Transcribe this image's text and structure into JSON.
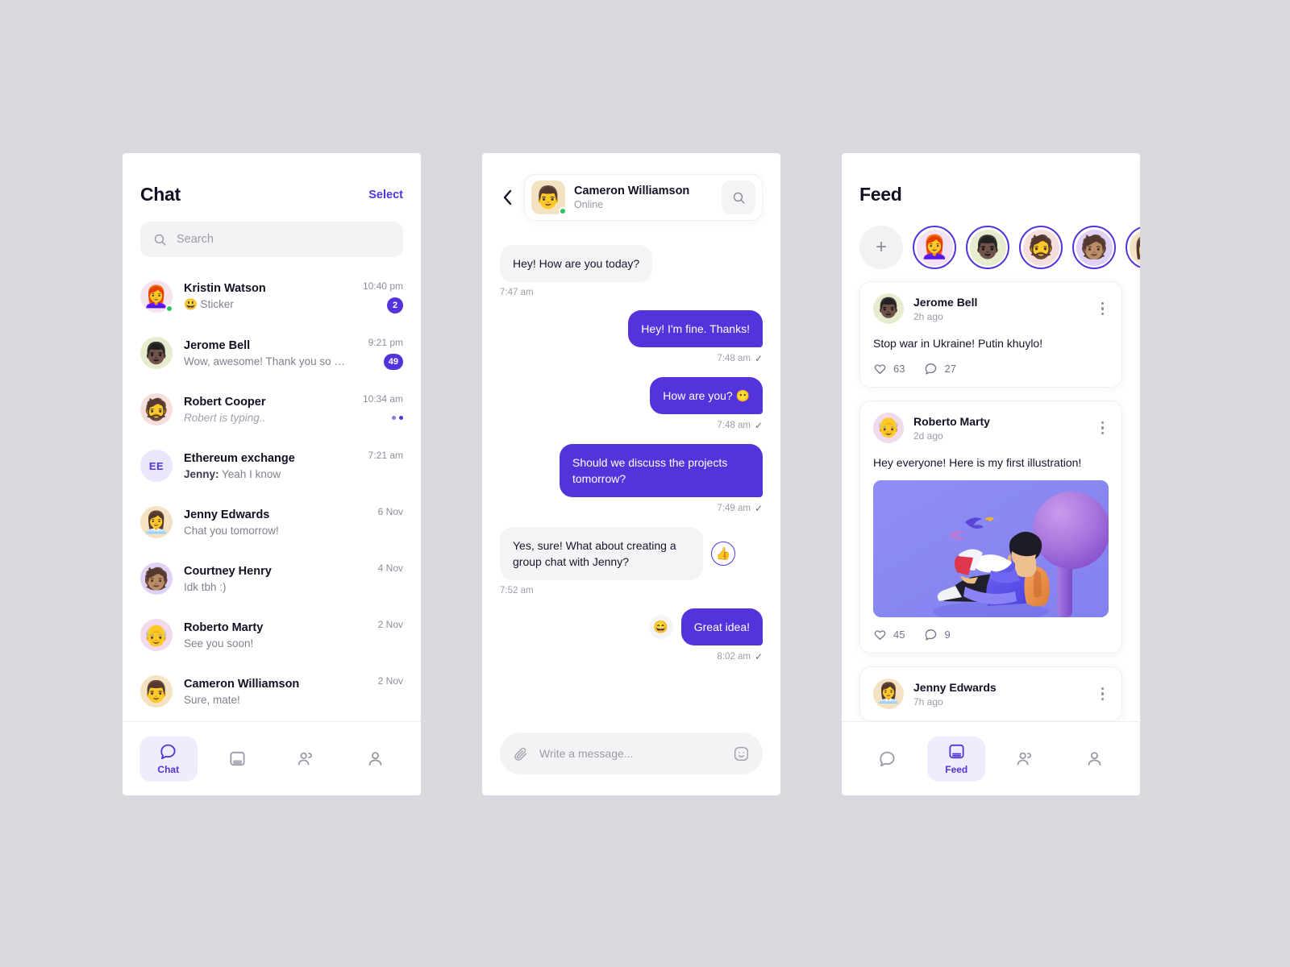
{
  "theme": {
    "accent": "#5433dc",
    "accent_soft": "#efecfd",
    "bg": "#d9dadf",
    "panel": "#ffffff",
    "muted": "#9a9aa8",
    "online": "#2fc05c"
  },
  "chat_panel": {
    "title": "Chat",
    "select_label": "Select",
    "search": {
      "placeholder": "Search",
      "value": "",
      "icon": "search-icon"
    },
    "rows": [
      {
        "name": "Kristin Watson",
        "preview": "😃 Sticker",
        "sender": "",
        "time": "10:40 pm",
        "badge": "2",
        "typing": false,
        "online": true,
        "emoji": "👩‍🦰",
        "av_bg": "#f5e4f0",
        "initials": ""
      },
      {
        "name": "Jerome Bell",
        "preview": "Wow, awesome! Thank you so much..",
        "sender": "",
        "time": "9:21 pm",
        "badge": "49",
        "typing": false,
        "online": false,
        "emoji": "👨🏿",
        "av_bg": "#e6edcf",
        "initials": ""
      },
      {
        "name": "Robert Cooper",
        "preview": "Robert is typing..",
        "sender": "",
        "time": "10:34 am",
        "badge": "",
        "typing": true,
        "online": false,
        "emoji": "🧔",
        "av_bg": "#f6dedc",
        "initials": ""
      },
      {
        "name": "Ethereum exchange",
        "preview": "Yeah I know",
        "sender": "Jenny:",
        "time": "7:21 am",
        "badge": "",
        "typing": false,
        "online": false,
        "emoji": "",
        "av_bg": "#eae6fb",
        "initials": "EE"
      },
      {
        "name": "Jenny Edwards",
        "preview": "Chat you tomorrow!",
        "sender": "",
        "time": "6 Nov",
        "badge": "",
        "typing": false,
        "online": false,
        "emoji": "👩‍💼",
        "av_bg": "#f3e3c2",
        "initials": ""
      },
      {
        "name": "Courtney Henry",
        "preview": "Idk tbh :)",
        "sender": "",
        "time": "4 Nov",
        "badge": "",
        "typing": false,
        "online": false,
        "emoji": "🧑🏽",
        "av_bg": "#dfd2f5",
        "initials": ""
      },
      {
        "name": "Roberto Marty",
        "preview": "See you soon!",
        "sender": "",
        "time": "2 Nov",
        "badge": "",
        "typing": false,
        "online": false,
        "emoji": "👴",
        "av_bg": "#f0daec",
        "initials": ""
      },
      {
        "name": "Cameron Williamson",
        "preview": "Sure, mate!",
        "sender": "",
        "time": "2 Nov",
        "badge": "",
        "typing": false,
        "online": false,
        "emoji": "👨",
        "av_bg": "#f3e3c2",
        "initials": ""
      }
    ],
    "tabs": [
      {
        "label": "Chat",
        "icon": "chat-bubble-icon",
        "active": true
      },
      {
        "label": "",
        "icon": "feed-icon",
        "active": false
      },
      {
        "label": "",
        "icon": "contacts-icon",
        "active": false
      },
      {
        "label": "",
        "icon": "profile-icon",
        "active": false
      }
    ]
  },
  "conversation_panel": {
    "back_icon": "chevron-left-icon",
    "search_icon": "search-icon",
    "contact": {
      "name": "Cameron Williamson",
      "status": "Online",
      "emoji": "👨",
      "av_bg": "#f3e3c2",
      "online": true
    },
    "messages": [
      {
        "dir": "in",
        "text": "Hey! How are you today?",
        "time": "7:47 am",
        "read": false,
        "reaction": ""
      },
      {
        "dir": "out",
        "text": "Hey! I'm fine. Thanks!",
        "time": "7:48 am",
        "read": true,
        "reaction": ""
      },
      {
        "dir": "out",
        "text": "How are you? 😶",
        "time": "7:48 am",
        "read": true,
        "reaction": ""
      },
      {
        "dir": "out",
        "text": "Should we discuss the projects tomorrow?",
        "time": "7:49 am",
        "read": true,
        "reaction": ""
      },
      {
        "dir": "in",
        "text": "Yes, sure! What about creating a group chat with Jenny?",
        "time": "7:52 am",
        "read": false,
        "reaction": "👍",
        "reaction_style": "liked"
      },
      {
        "dir": "out",
        "text": "Great idea!",
        "time": "8:02 am",
        "read": true,
        "reaction": "😄",
        "reaction_style": "plain"
      }
    ],
    "composer": {
      "placeholder": "Write a message...",
      "value": "",
      "attach_icon": "paperclip-icon",
      "emoji_icon": "emoji-smile-icon"
    }
  },
  "feed_panel": {
    "title": "Feed",
    "add_story_icon": "plus-icon",
    "stories": [
      {
        "emoji": "👩‍🦰",
        "bg": "#f2e2f2"
      },
      {
        "emoji": "👨🏿",
        "bg": "#e6edcf"
      },
      {
        "emoji": "🧔",
        "bg": "#f6dedc"
      },
      {
        "emoji": "🧑🏽",
        "bg": "#dfd2f5"
      },
      {
        "emoji": "👩",
        "bg": "#f3e3c2"
      }
    ],
    "posts": [
      {
        "name": "Jerome Bell",
        "time": "2h ago",
        "emoji": "👨🏿",
        "av_bg": "#e6edcf",
        "text": "Stop war in Ukraine! Putin khuylo!",
        "has_media": false,
        "likes": "63",
        "comments": "27",
        "menu_icon": "kebab-menu-icon"
      },
      {
        "name": "Roberto Marty",
        "time": "2d ago",
        "emoji": "👴",
        "av_bg": "#f0daec",
        "text": "Hey everyone! Here is my first illustration!",
        "has_media": true,
        "media_alt": "3d-illustration-person-reading-book-under-tree",
        "likes": "45",
        "comments": "9",
        "menu_icon": "kebab-menu-icon"
      },
      {
        "name": "Jenny Edwards",
        "time": "7h ago",
        "emoji": "👩‍💼",
        "av_bg": "#f3e3c2",
        "text": "",
        "has_media": false,
        "likes": "",
        "comments": "",
        "menu_icon": "kebab-menu-icon"
      }
    ],
    "tabs": [
      {
        "label": "",
        "icon": "chat-bubble-icon",
        "active": false
      },
      {
        "label": "Feed",
        "icon": "feed-icon",
        "active": true
      },
      {
        "label": "",
        "icon": "contacts-icon",
        "active": false
      },
      {
        "label": "",
        "icon": "profile-icon",
        "active": false
      }
    ]
  }
}
